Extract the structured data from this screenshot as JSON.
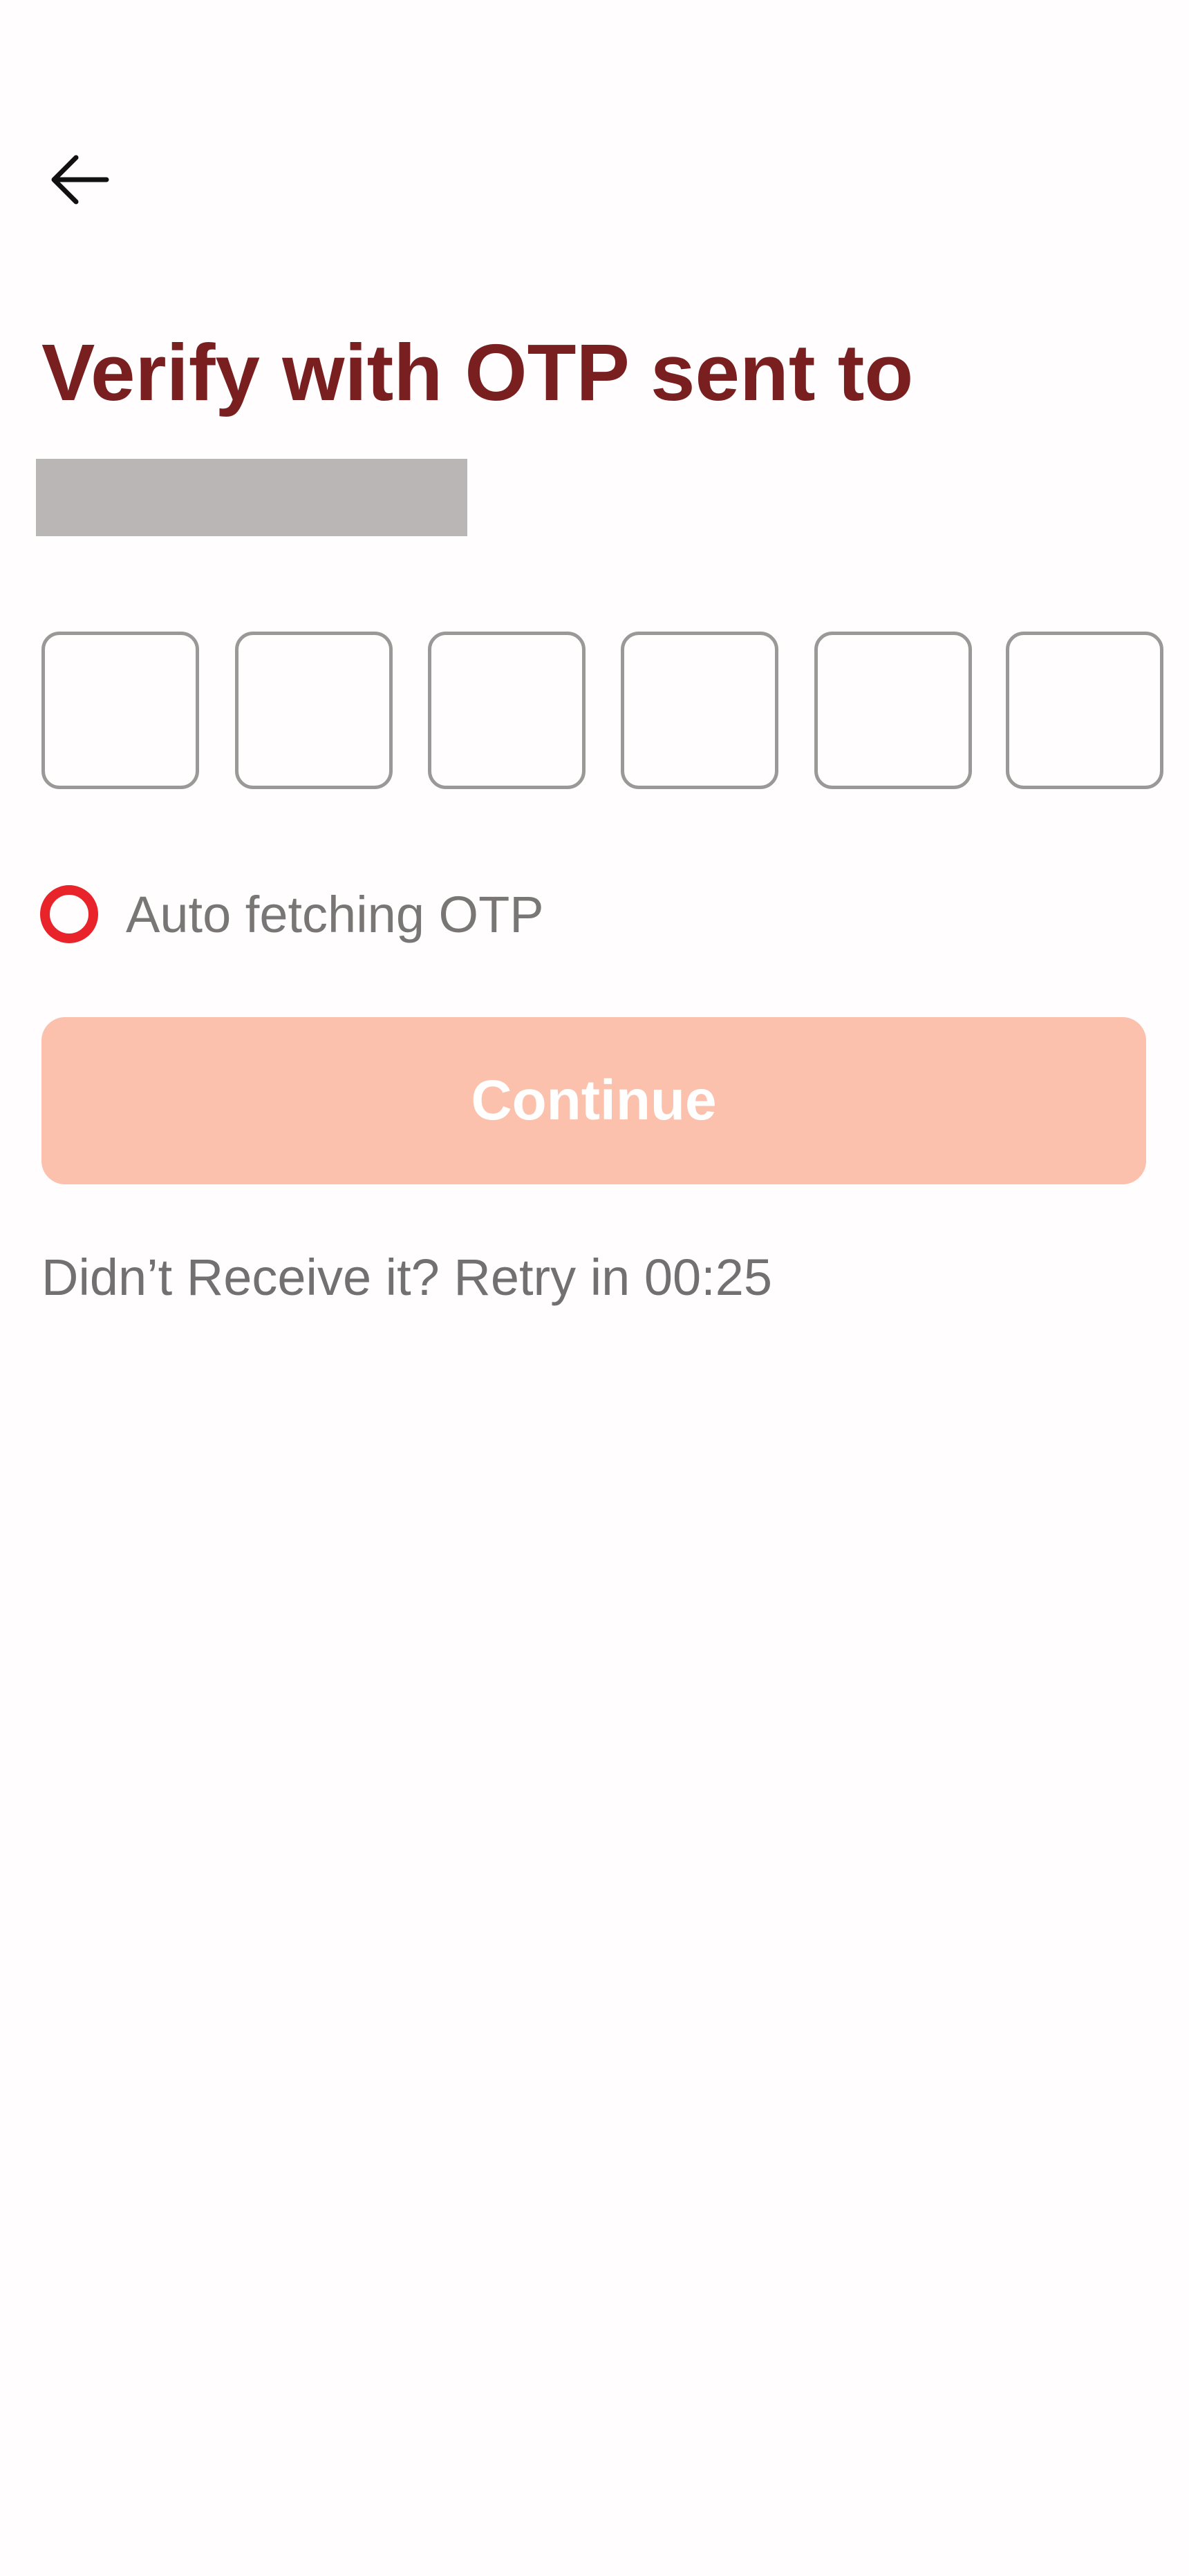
{
  "header": {
    "back_icon": "arrow-left-icon"
  },
  "verify": {
    "title": "Verify with OTP sent to"
  },
  "otp": {
    "digits": [
      "",
      "",
      "",
      "",
      "",
      ""
    ]
  },
  "auto_fetch": {
    "label": "Auto fetching OTP",
    "icon": "loading-ring-icon"
  },
  "continue": {
    "label": "Continue"
  },
  "retry": {
    "text": "Didn’t Receive it? Retry in 00:25"
  },
  "colors": {
    "title": "#7a1f20",
    "accent_red": "#e8232a",
    "button_disabled": "#fbc1ad",
    "masked_block": "#bbb6b6",
    "input_border": "#9b9898"
  }
}
